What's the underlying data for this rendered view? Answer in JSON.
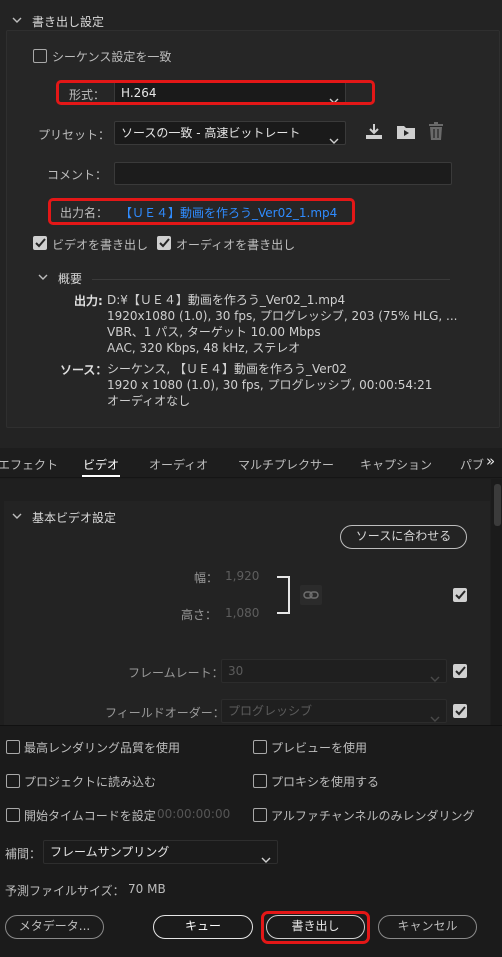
{
  "export_settings": {
    "section_title": "書き出し設定",
    "match_sequence_label": "シーケンス設定を一致",
    "format_label": "形式：",
    "format_value": "H.264",
    "preset_label": "プリセット：",
    "preset_value": "ソースの一致 - 高速ビットレート",
    "comment_label": "コメント：",
    "comment_value": "",
    "output_name_label": "出力名：",
    "output_name_value": "【ＵＥ４】動画を作ろう_Ver02_1.mp4",
    "export_video_label": "ビデオを書き出し",
    "export_audio_label": "オーディオを書き出し",
    "summary_title": "概要",
    "output_label": "出力:",
    "output_lines": [
      "D:¥【ＵＥ４】動画を作ろう_Ver02_1.mp4",
      "1920x1080 (1.0), 30 fps, プログレッシブ, 203 (75% HLG, ...",
      "VBR、1 パス, ターゲット 10.00 Mbps",
      "AAC, 320 Kbps, 48 kHz, ステレオ"
    ],
    "source_label": "ソース：",
    "source_lines": [
      "シーケンス, 【ＵＥ４】動画を作ろう_Ver02",
      "1920 x 1080 (1.0), 30 fps, プログレッシブ, 00:00:54:21",
      "オーディオなし"
    ]
  },
  "tabs": [
    "エフェクト",
    "ビデオ",
    "オーディオ",
    "マルチプレクサー",
    "キャプション",
    "パブ"
  ],
  "tabs_more": "»",
  "video": {
    "section_title": "基本ビデオ設定",
    "match_source_button": "ソースに合わせる",
    "width_label": "幅：",
    "width_value": "1,920",
    "height_label": "高さ：",
    "height_value": "1,080",
    "frame_rate_label": "フレームレート：",
    "frame_rate_value": "30",
    "field_order_label": "フィールドオーダー：",
    "field_order_value": "プログレッシブ"
  },
  "bottom": {
    "max_render_quality": "最高レンダリング品質を使用",
    "use_preview": "プレビューを使用",
    "import_into_project": "プロジェクトに読み込む",
    "use_proxy": "プロキシを使用する",
    "set_start_timecode": "開始タイムコードを設定",
    "start_timecode_value": "00:00:00:00",
    "alpha_only": "アルファチャンネルのみレンダリング",
    "interpolation_label": "補間：",
    "interpolation_value": "フレームサンプリング",
    "estimated_size_label": "予測ファイルサイズ：",
    "estimated_size_value": "70 MB",
    "metadata_button": "メタデータ...",
    "queue_button": "キュー",
    "export_button": "書き出し",
    "cancel_button": "キャンセル"
  },
  "colors": {
    "highlight_red": "#e31717",
    "link_blue": "#2f8cff"
  }
}
